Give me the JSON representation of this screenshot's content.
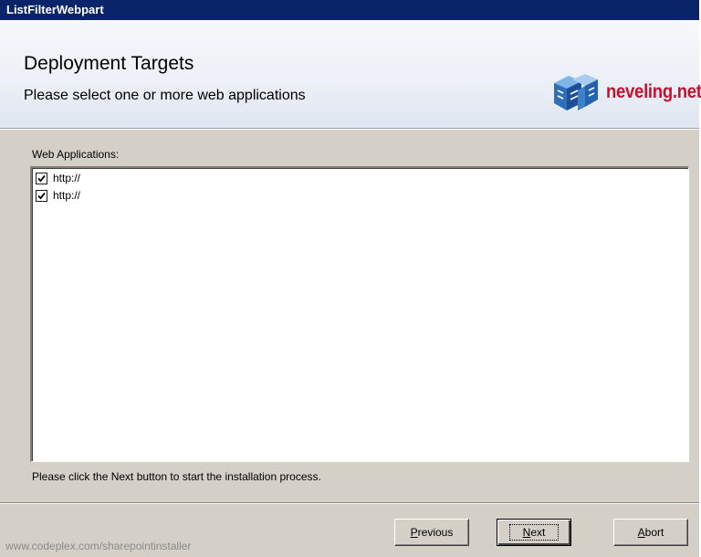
{
  "window": {
    "title": "ListFilterWebpart"
  },
  "banner": {
    "title": "Deployment Targets",
    "subtitle": "Please select one or more web applications",
    "logo_text": "neveling.net",
    "logo_icon": "neveling-cube-logo-icon",
    "logo_color": "#c8102e"
  },
  "web_applications": {
    "label": "Web Applications:",
    "items": [
      {
        "label": "http://",
        "checked": true
      },
      {
        "label": "http://",
        "checked": true
      }
    ]
  },
  "hint": "Please click the Next button to start the installation process.",
  "footer": {
    "link_text": "www.codeplex.com/sharepointinstaller"
  },
  "buttons": {
    "previous": {
      "mnemonic": "P",
      "rest": "revious"
    },
    "next": {
      "mnemonic": "N",
      "rest": "ext"
    },
    "abort": {
      "mnemonic": "A",
      "rest": "bort"
    }
  },
  "colors": {
    "titlebar": "#0a246a",
    "dialog": "#d4d0c8"
  }
}
